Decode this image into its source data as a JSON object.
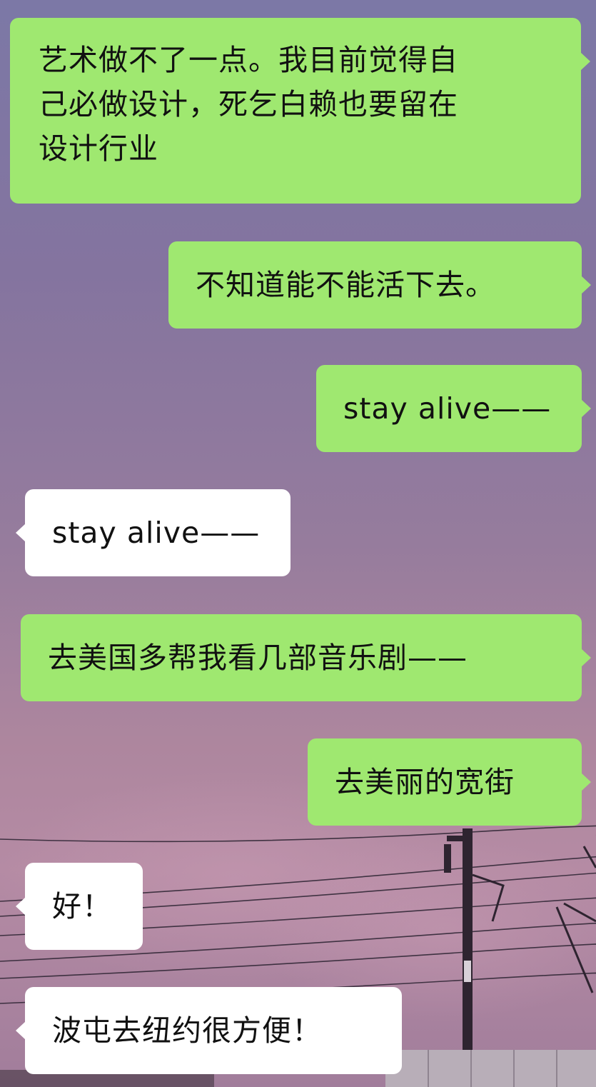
{
  "chat": {
    "messages": [
      {
        "side": "out",
        "lines": [
          "艺术做不了一点。我目前觉得自",
          "己必做设计，死乞白赖也要留在",
          "设计行业"
        ]
      },
      {
        "side": "out",
        "text": "不知道能不能活下去。"
      },
      {
        "side": "out",
        "text": "stay alive——"
      },
      {
        "side": "in",
        "text": "stay alive——"
      },
      {
        "side": "out",
        "text": "去美国多帮我看几部音乐剧——"
      },
      {
        "side": "out",
        "text": "去美丽的宽街"
      },
      {
        "side": "in",
        "text": "好！"
      },
      {
        "side": "in",
        "text": "波屯去纽约很方便！"
      }
    ]
  },
  "colors": {
    "outgoing_bubble": "#9fe870",
    "incoming_bubble": "#ffffff",
    "sky_top": "#7c78a6",
    "sky_bottom": "#b58ba4"
  },
  "background": {
    "scene": "purple-sky-with-power-lines"
  }
}
